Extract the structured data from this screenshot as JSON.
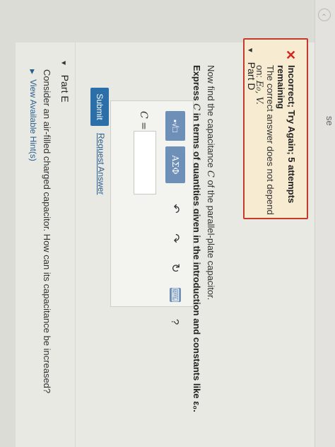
{
  "sidebar": {
    "cut_text": "se"
  },
  "feedback": {
    "title": "Incorrect; Try Again; 5 attempts remaining",
    "message_prefix": "The correct answer does not depend on:",
    "message_vars": "E₀, V."
  },
  "part_d": {
    "header": "Part D",
    "instruction_pre": "Now find the capacitance ",
    "instruction_var": "C",
    "instruction_post": " of the parallel-plate capacitor.",
    "express_pre": "Express ",
    "express_var": "C",
    "express_post": " in terms of quantities given in the introduction and constants like ε₀.",
    "toolbar": {
      "template_label": "▪√□",
      "greek_label": "ΑΣΦ",
      "undo_icon": "undo-icon",
      "redo_icon": "redo-icon",
      "reset_icon": "reset-icon",
      "keyboard_icon": "keyboard-icon",
      "help_label": "?"
    },
    "answer_label": "C =",
    "answer_value": "",
    "submit_label": "Submit",
    "request_label": "Request Answer"
  },
  "part_e": {
    "header": "Part E",
    "question": "Consider an air-filled charged capacitor. How can its capacitance be increased?",
    "hints_label": "View Available Hint(s)"
  },
  "colors": {
    "error_red": "#c73a2b",
    "error_bg": "#f7ecd2",
    "toolbar_blue": "#6d8fb8",
    "submit_blue": "#2b6ea8",
    "link_blue": "#2b5f91"
  }
}
